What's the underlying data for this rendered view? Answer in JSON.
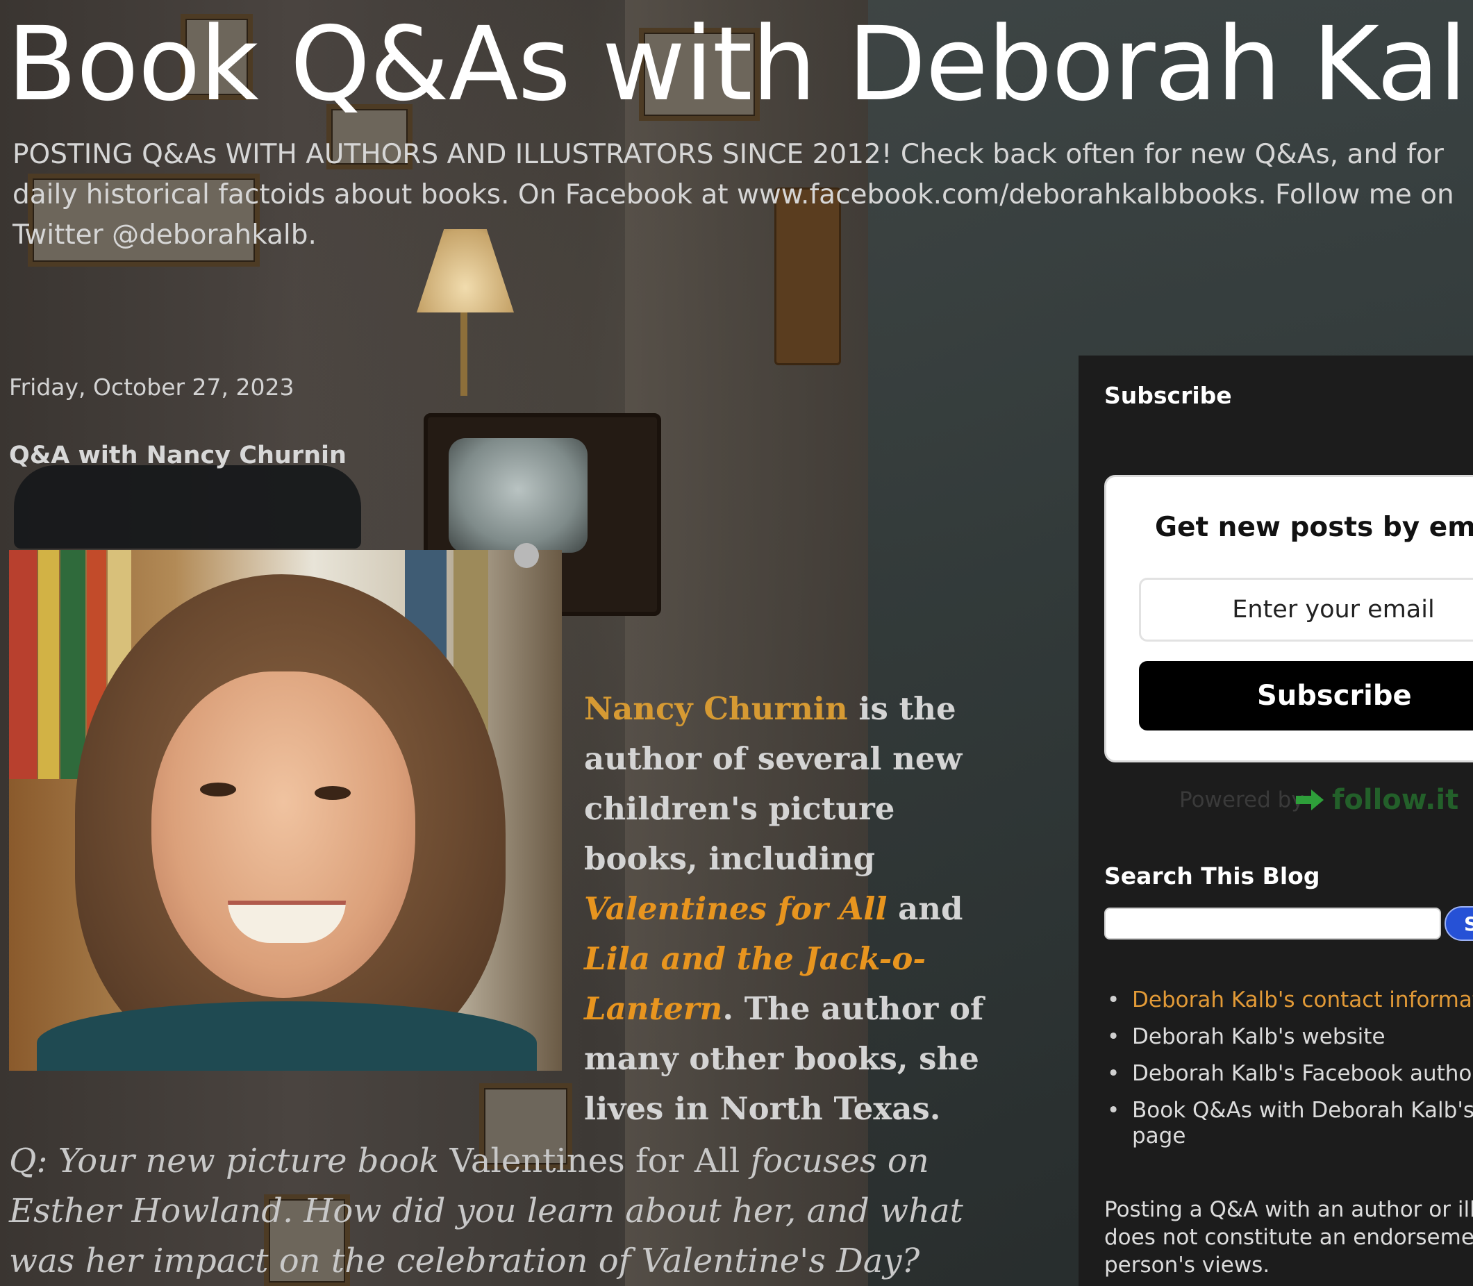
{
  "header": {
    "title": "Book Q&As with Deborah Kalb",
    "description": "POSTING Q&As WITH AUTHORS AND ILLUSTRATORS SINCE 2012! Check back often for new Q&As, and for daily historical factoids about books. On Facebook at www.facebook.com/deborahkalbbooks. Follow me on Twitter @deborahkalb."
  },
  "post": {
    "date": "Friday, October 27, 2023",
    "title": "Q&A with Nancy Churnin",
    "intro": {
      "author_name": "Nancy Churnin",
      "text1": " is the author of several new children's picture books, including ",
      "book1": "Valentines for All",
      "text2": " and ",
      "book2": "Lila and the Jack-o-Lantern",
      "text3": ". The author of many other books, she lives in North Texas."
    },
    "question": {
      "prefix": "Q: Your new picture book ",
      "book": "Valentines for All",
      "suffix": " focuses on Esther Howland. How did you learn about her, and what was her impact on the celebration of Valentine's Day?"
    }
  },
  "sidebar": {
    "subscribe_heading": "Subscribe",
    "followit": {
      "heading": "Get new posts by ema",
      "email_placeholder": "Enter your email",
      "button_label": "Subscribe",
      "powered_by": "Powered by",
      "logo_text": "follow.it"
    },
    "search": {
      "heading": "Search This Blog",
      "button_label": "S"
    },
    "links": [
      {
        "label": "Deborah Kalb's contact informatio",
        "color": "#e29a37"
      },
      {
        "label": "Deborah Kalb's website"
      },
      {
        "label": "Deborah Kalb's Facebook author p"
      },
      {
        "label": "Book Q&As with Deborah Kalb's Fa",
        "label_line2": "page"
      }
    ],
    "disclaimer_lines": [
      "Posting a Q&A with an author or illus",
      "does not constitute an endorsement",
      "person's views."
    ]
  },
  "colors": {
    "accent_orange": "#e8951f",
    "author_name": "#d69a33",
    "search_button": "#2651d6",
    "followit_green": "#2e9f3a"
  }
}
